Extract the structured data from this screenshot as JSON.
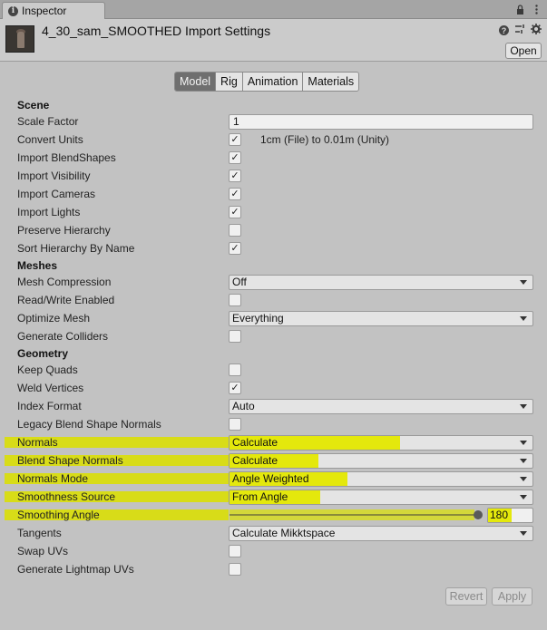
{
  "window": {
    "tab_label": "Inspector"
  },
  "header": {
    "title": "4_30_sam_SMOOTHED Import Settings",
    "open_label": "Open"
  },
  "tabs": [
    "Model",
    "Rig",
    "Animation",
    "Materials"
  ],
  "active_tab": "Model",
  "sections": {
    "scene": "Scene",
    "meshes": "Meshes",
    "geometry": "Geometry"
  },
  "fields": {
    "scale_factor": {
      "label": "Scale Factor",
      "value": "1"
    },
    "convert_units": {
      "label": "Convert Units",
      "checked": true,
      "note": "1cm (File) to 0.01m (Unity)"
    },
    "import_blendshapes": {
      "label": "Import BlendShapes",
      "checked": true
    },
    "import_visibility": {
      "label": "Import Visibility",
      "checked": true
    },
    "import_cameras": {
      "label": "Import Cameras",
      "checked": true
    },
    "import_lights": {
      "label": "Import Lights",
      "checked": true
    },
    "preserve_hierarchy": {
      "label": "Preserve Hierarchy",
      "checked": false
    },
    "sort_hierarchy": {
      "label": "Sort Hierarchy By Name",
      "checked": true
    },
    "mesh_compression": {
      "label": "Mesh Compression",
      "value": "Off"
    },
    "read_write": {
      "label": "Read/Write Enabled",
      "checked": false
    },
    "optimize_mesh": {
      "label": "Optimize Mesh",
      "value": "Everything"
    },
    "generate_colliders": {
      "label": "Generate Colliders",
      "checked": false
    },
    "keep_quads": {
      "label": "Keep Quads",
      "checked": false
    },
    "weld_vertices": {
      "label": "Weld Vertices",
      "checked": true
    },
    "index_format": {
      "label": "Index Format",
      "value": "Auto"
    },
    "legacy_blend": {
      "label": "Legacy Blend Shape Normals",
      "checked": false
    },
    "normals": {
      "label": "Normals",
      "value": "Calculate"
    },
    "blend_shape_normals": {
      "label": "Blend Shape Normals",
      "value": "Calculate"
    },
    "normals_mode": {
      "label": "Normals Mode",
      "value": "Angle Weighted"
    },
    "smoothness_source": {
      "label": "Smoothness Source",
      "value": "From Angle"
    },
    "smoothing_angle": {
      "label": "Smoothing Angle",
      "value": "180",
      "slider_fraction": 1.0
    },
    "tangents": {
      "label": "Tangents",
      "value": "Calculate Mikktspace"
    },
    "swap_uvs": {
      "label": "Swap UVs",
      "checked": false
    },
    "lightmap_uvs": {
      "label": "Generate Lightmap UVs",
      "checked": false
    }
  },
  "footer": {
    "revert_label": "Revert",
    "apply_label": "Apply"
  },
  "colors": {
    "highlight": "#d8dc18",
    "background": "#c2c2c2",
    "active_tab": "#6f6f6f"
  },
  "icons": [
    "info-icon",
    "lock-icon",
    "menu-icon",
    "help-icon",
    "preset-icon",
    "gear-icon",
    "checkmark-icon",
    "caret-down-icon"
  ]
}
